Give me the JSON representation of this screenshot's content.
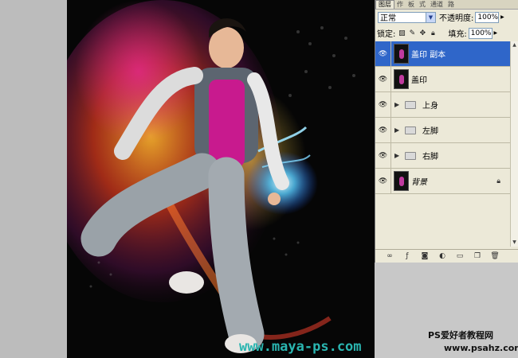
{
  "panel": {
    "tabs": [
      "图层",
      "作",
      "板",
      "式",
      "通道",
      "路"
    ],
    "blend_mode": "正常",
    "opacity_label": "不透明度:",
    "opacity_value": "100%",
    "lock_label": "锁定:",
    "fill_label": "填充:",
    "fill_value": "100%"
  },
  "layers": [
    {
      "name": "盖印 副本",
      "type": "layer",
      "selected": true
    },
    {
      "name": "盖印",
      "type": "layer",
      "selected": false
    },
    {
      "name": "上身",
      "type": "group",
      "selected": false
    },
    {
      "name": "左脚",
      "type": "group",
      "selected": false
    },
    {
      "name": "右脚",
      "type": "group",
      "selected": false
    },
    {
      "name": "背景",
      "type": "background",
      "selected": false,
      "locked": true
    }
  ],
  "icons": {
    "visibility": "eye-icon",
    "group": "folder-icon",
    "expand": "triangle-right-icon",
    "lock": "lock-icon"
  },
  "watermarks": {
    "main": "www.maya-ps.com",
    "site_title": "PS爱好者教程网",
    "site_url": "www.psahz.com"
  }
}
